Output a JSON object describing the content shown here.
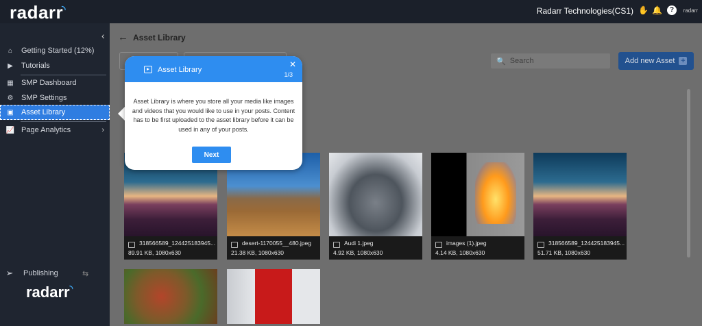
{
  "topbar": {
    "logo": "radarr",
    "org_name": "Radarr Technologies(CS1)",
    "mini_logo": "radarr"
  },
  "sidebar": {
    "items": [
      {
        "label": "Getting Started (12%)",
        "icon": "home-icon"
      },
      {
        "label": "Tutorials",
        "icon": "video-icon"
      },
      {
        "label": "SMP Dashboard",
        "icon": "dashboard-icon"
      },
      {
        "label": "SMP Settings",
        "icon": "gear-icon"
      },
      {
        "label": "Asset Library",
        "icon": "play-box-icon",
        "active": true
      },
      {
        "label": "Page Analytics",
        "icon": "analytics-icon"
      }
    ],
    "publishing_label": "Publishing",
    "bottom_logo": "radarr"
  },
  "main": {
    "title": "Asset Library",
    "search_placeholder": "Search",
    "add_button_label": "Add new Asset",
    "assets": [
      {
        "name": "318566589_124425183945...",
        "info": "89.91 KB, 1080x630"
      },
      {
        "name": "desert-1170055__480.jpeg",
        "info": "21.38 KB, 1080x630"
      },
      {
        "name": "Audi 1.jpeg",
        "info": "4.92 KB, 1080x630"
      },
      {
        "name": "images (1).jpeg",
        "info": "4.14 KB, 1080x630"
      },
      {
        "name": "318566589_124425183945...",
        "info": "51.71 KB, 1080x630"
      }
    ]
  },
  "popover": {
    "title": "Asset Library",
    "step": "1/3",
    "body": "Asset Library is where you store all your media like images and videos that you would like to use in your posts. Content has to be first uploaded to the asset library before it can be used in any of your posts.",
    "next_label": "Next"
  }
}
